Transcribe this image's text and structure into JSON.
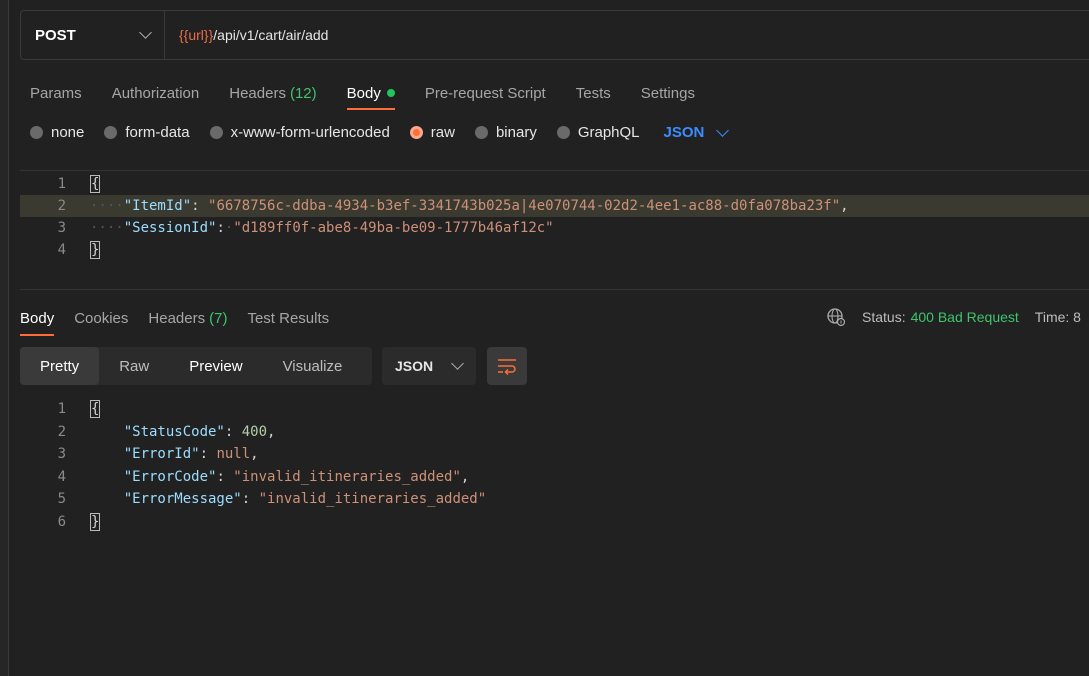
{
  "request": {
    "method": "POST",
    "url_var": "{{url}}",
    "url_path": "/api/v1/cart/air/add"
  },
  "tabs": [
    {
      "label": "Params"
    },
    {
      "label": "Authorization"
    },
    {
      "label": "Headers",
      "count": "(12)"
    },
    {
      "label": "Body"
    },
    {
      "label": "Pre-request Script"
    },
    {
      "label": "Tests"
    },
    {
      "label": "Settings"
    }
  ],
  "body_types": [
    "none",
    "form-data",
    "x-www-form-urlencoded",
    "raw",
    "binary",
    "GraphQL"
  ],
  "body_language": "JSON",
  "request_body": {
    "line_numbers": [
      "1",
      "2",
      "3",
      "4"
    ],
    "open": "{",
    "close": "}",
    "k1": "\"ItemId\"",
    "v1": "\"6678756c-ddba-4934-b3ef-3341743b025a|4e070744-02d2-4ee1-ac88-d0fa078ba23f\"",
    "k2": "\"SessionId\"",
    "v2": "\"d189ff0f-abe8-49ba-be09-1777b46af12c\""
  },
  "response_tabs": [
    {
      "label": "Body"
    },
    {
      "label": "Cookies"
    },
    {
      "label": "Headers",
      "count": "(7)"
    },
    {
      "label": "Test Results"
    }
  ],
  "status": {
    "label": "Status:",
    "value": "400 Bad Request",
    "time_label": "Time: 8"
  },
  "views": [
    "Pretty",
    "Raw",
    "Preview",
    "Visualize"
  ],
  "response_format": "JSON",
  "response_body": {
    "line_numbers": [
      "1",
      "2",
      "3",
      "4",
      "5",
      "6"
    ],
    "open": "{",
    "close": "}",
    "k1": "\"StatusCode\"",
    "v1": "400",
    "k2": "\"ErrorId\"",
    "v2": "null",
    "k3": "\"ErrorCode\"",
    "v3": "\"invalid_itineraries_added\"",
    "k4": "\"ErrorMessage\"",
    "v4": "\"invalid_itineraries_added\""
  },
  "colors": {
    "accent": "#ff6c37",
    "success": "#3ec46d",
    "link": "#3b8cff"
  }
}
